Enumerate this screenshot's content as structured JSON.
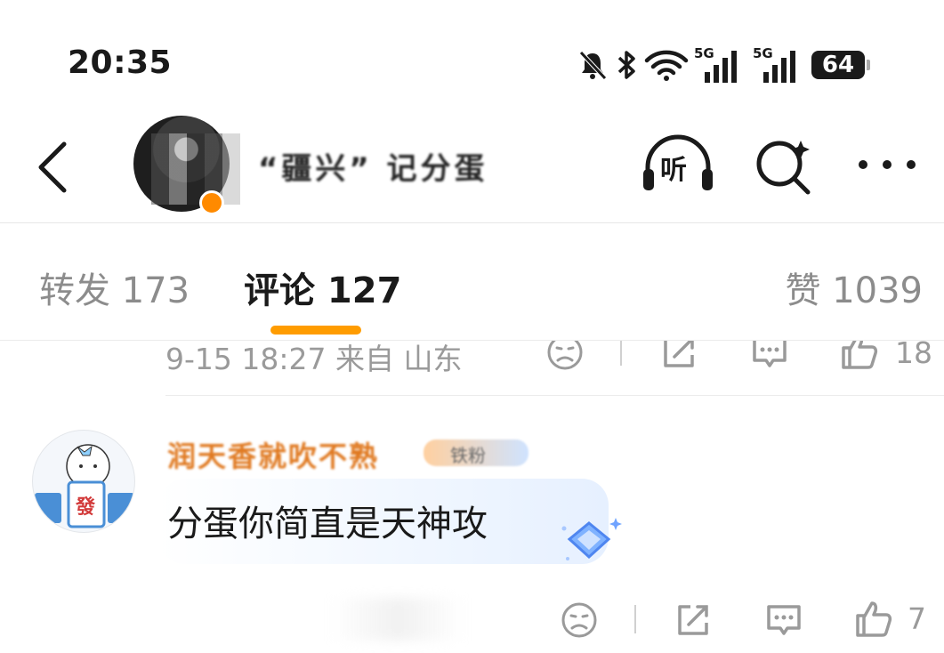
{
  "status_bar": {
    "time": "20:35",
    "battery": "64",
    "signal_label_1": "5G",
    "signal_label_2": "5G"
  },
  "header": {
    "username": "“疆兴” 记分蛋",
    "listen_label": "听"
  },
  "tabs": [
    {
      "label": "转发 173"
    },
    {
      "label": "评论 127"
    },
    {
      "label": "赞 1039"
    }
  ],
  "prev_comment": {
    "meta": "9-15 18:27  来自 山东",
    "like_count": "18"
  },
  "comment": {
    "author": "润天香就吹不熟",
    "badge": "铁粉",
    "text": "分蛋你简直是天神攻",
    "like_count": "7",
    "avatar_glyph": "發"
  },
  "colors": {
    "accent": "#ff9c00",
    "author_name": "#e07a22",
    "muted": "#9a9a9a"
  },
  "icons": [
    "bell-off-icon",
    "bluetooth-icon",
    "wifi-icon",
    "signal-icon",
    "battery-icon",
    "back-icon",
    "headphones-icon",
    "search-sparkle-icon",
    "more-icon",
    "sad-face-icon",
    "share-icon",
    "comment-icon",
    "thumbs-up-icon",
    "diamond-icon"
  ]
}
